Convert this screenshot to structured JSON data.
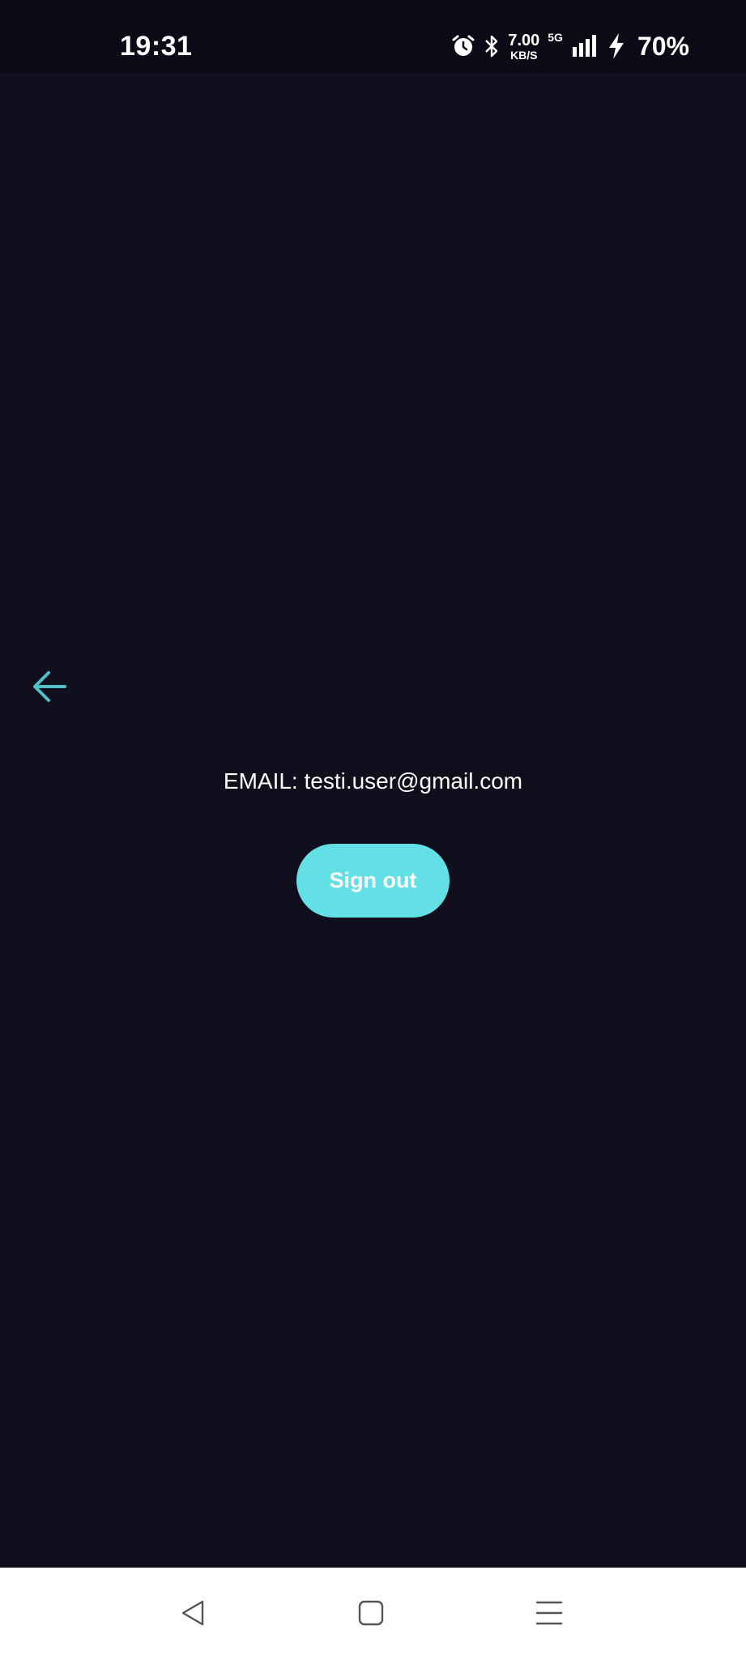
{
  "status_bar": {
    "time": "19:31",
    "net_speed_value": "7.00",
    "net_speed_unit": "KB/S",
    "network_type": "5G",
    "battery_percent": "70%",
    "icons": [
      "alarm-icon",
      "bluetooth-icon",
      "signal-icon",
      "charging-icon"
    ]
  },
  "main": {
    "back_icon": "arrow-left-icon",
    "email_text": "EMAIL: testi.user@gmail.com",
    "sign_out_label": "Sign out"
  },
  "nav_bar": {
    "icons": [
      "nav-back-icon",
      "nav-home-icon",
      "nav-menu-icon"
    ]
  },
  "colors": {
    "background": "#0f0f1e",
    "accent": "#62e0e6",
    "back_arrow": "#4fbfc7",
    "text": "#ffffff",
    "nav_background": "#ffffff"
  }
}
